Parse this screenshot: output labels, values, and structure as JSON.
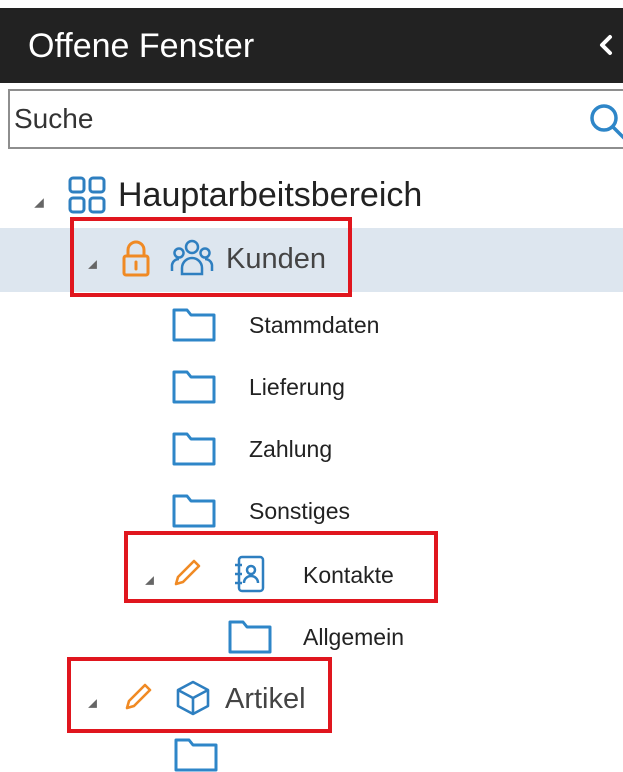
{
  "header": {
    "title": "Offene Fenster",
    "collapse_icon": "chevron-left-icon"
  },
  "search": {
    "placeholder": "Suche",
    "value": "",
    "icon": "search-icon"
  },
  "colors": {
    "folder": "#2e86c8",
    "entity_icon": "#2e7fc0",
    "edit_icon": "#f08a24",
    "highlight": "#e0161e",
    "selected_row": "#dde6ef"
  },
  "tree": {
    "root": {
      "label": "Hauptarbeitsbereich",
      "icon": "workspace-grid-icon"
    },
    "kunden": {
      "label": "Kunden",
      "status_icon": "lock-icon",
      "icon": "people-icon",
      "children": [
        "Stammdaten",
        "Lieferung",
        "Zahlung",
        "Sonstiges"
      ]
    },
    "kontakte": {
      "label": "Kontakte",
      "status_icon": "pencil-icon",
      "icon": "contact-book-icon",
      "children": [
        "Allgemein"
      ]
    },
    "artikel": {
      "label": "Artikel",
      "status_icon": "pencil-icon",
      "icon": "cube-icon"
    }
  }
}
